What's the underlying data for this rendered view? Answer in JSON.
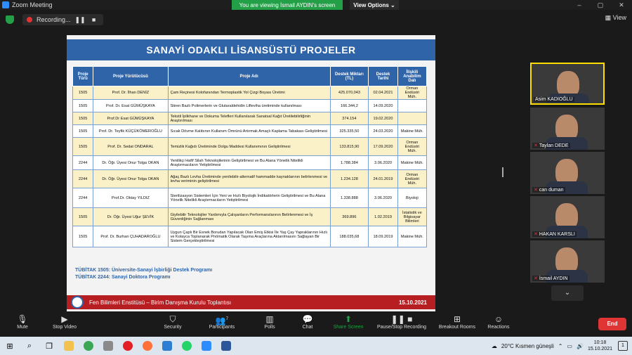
{
  "window": {
    "title": "Zoom Meeting",
    "viewing_banner": "You are viewing İsmail AYDIN's screen",
    "view_options": "View Options ⌄"
  },
  "recording": {
    "label": "Recording..."
  },
  "view_button": "View",
  "slide": {
    "title": "SANAYİ ODAKLI LİSANSÜSTÜ PROJELER",
    "headers": [
      "Proje Türü",
      "Proje Yürütücüsü",
      "Proje Adı",
      "Destek Miktarı (TL)",
      "Destek Tarihi",
      "İlişkili Anabilim Dalı"
    ],
    "rows": [
      [
        "1505",
        "Prof. Dr. İlhan DENİZ",
        "Çam Reçinesi Kolofanından Termoplastik Yol Çizgi Boyası Üretimi",
        "425.070,043",
        "02.04.2021",
        "Orman Endüstri Müh."
      ],
      [
        "1505",
        "Prof. Dr. Esat GÜMÜŞKAYA",
        "Stiren Bazlı Polimerlerin ve Glutaraldehidin Lifleviha üretiminde kullanılması",
        "166.344,2",
        "14.09.2020",
        ""
      ],
      [
        "1505",
        "Prof.Dr Esat GÜMÜŞKAYA",
        "Tekstil İplikhane ve Dokuma Telefleri Kullanılarak Sanatsal Kağıt Üretilebilirliğinin Araştırılması",
        "374.154",
        "19.02.2020",
        ""
      ],
      [
        "1505",
        "Prof. Dr. Teyfik KÜÇÜKÖMEROĞLU",
        "Sıcak Dövme Kalıbının Kullanım Ömrünü Artırmak Amaçlı Kaplama Tabakası Geliştirilmesi",
        "325.335,50",
        "24.03.2020",
        "Makine Müh."
      ],
      [
        "1505",
        "Prof. Dr. Sedat ONDARAL",
        "Temizlik Kağıdı Üretiminde Dolgu Maddesi Kullanımının Geliştirilmesi",
        "133.815,90",
        "17.09.2020",
        "Orman Endüstri Müh."
      ],
      [
        "2244",
        "Dr. Öğr. Üyesi Onur Tolga OKAN",
        "Yenilikçi Hafif Silah Teknolojilerinin Geliştirilmesi ve Bu Alana Yönelik Nitelikli Araştırmacıların Yetiştirilmesi",
        "1.788.384",
        "3.06.2020",
        "Makine Müh."
      ],
      [
        "2244",
        "Dr. Öğr. Üyesi Onur Tolga OKAN",
        "Ağaç Bazlı Levha Üretiminde yenilebilir-alternatif hammadde kaynaklarının belirlenmesi ve levha veriminin geliştirilmesi",
        "1.234.128",
        "24.01.2019",
        "Orman Endüstri Müh."
      ],
      [
        "2244",
        "Prof.Dr. Oktay YILDIZ",
        "Sterilizasyon Sistemleri İçin Yeni ve Hızlı Biyolojik İndikatörlerin Geliştirilmesi ve Bu Alana Yönelik Nitelikli Araştırmacıların Yetiştirilmesi",
        "1.338.888",
        "3.06.2020",
        "Biyoloji"
      ],
      [
        "1505",
        "Dr. Öğr. Üyesi Uğur ŞEVİK",
        "Giyilebilir Teknolojiler Yardımıyla Çalışanların Performanslarının Belirlenmesi ve İş Güvenliğinin Sağlanması",
        "369.896",
        "1.02.2019",
        "İstatistik ve Bilgisayar Bilimleri"
      ],
      [
        "1505",
        "Prof. Dr. Burhan ÇUHADAROĞLU",
        "Uygun Çaplı Bir Esnek Borudan Yapılacak Olan Emiş Etkisi İle Yaş Çay Yapraklarının Hızlı ve Kolayca Toplanarak Pnömatik Olarak Taşıma Araçlarına Aktarılmasını Sağlayan Bir Sistem Gerçekleştirilmesi",
        "188.035,68",
        "18.09.2019",
        "Makine Müh."
      ]
    ],
    "footnote_1": "TÜBİTAK 1505: Üniversite-Sanayi İşbirliği Destek Programı",
    "footnote_2": "TÜBİTAK 2244: Sanayi Doktora Programı",
    "bottom_title": "Fen Bilimleri Enstitüsü – Birim Danışma Kurulu Toplantısı",
    "bottom_date": "15.10.2021"
  },
  "participants_panel": [
    {
      "name": "Asim KADIOĞLU",
      "muted": false
    },
    {
      "name": "Taylan DEDE",
      "muted": true
    },
    {
      "name": "can duman",
      "muted": true
    },
    {
      "name": "HAKAN KARSLI",
      "muted": true
    },
    {
      "name": "İsmail AYDIN",
      "muted": true
    }
  ],
  "toolbar": {
    "mute": "Mute",
    "stop_video": "Stop Video",
    "security": "Security",
    "participants": "Participants",
    "participants_count": "7",
    "polls": "Polls",
    "chat": "Chat",
    "share_screen": "Share Screen",
    "pause_recording": "Pause/Stop Recording",
    "breakout_rooms": "Breakout Rooms",
    "reactions": "Reactions",
    "end": "End"
  },
  "taskbar": {
    "weather": "20°C  Kısmen güneşli",
    "time": "10:18",
    "date": "15.10.2021"
  },
  "colors": {
    "zoom_green": "#23a047",
    "slide_blue": "#2f64a8",
    "slide_red": "#b61e22",
    "end_red": "#e03535",
    "active_speaker": "#ffde00"
  }
}
